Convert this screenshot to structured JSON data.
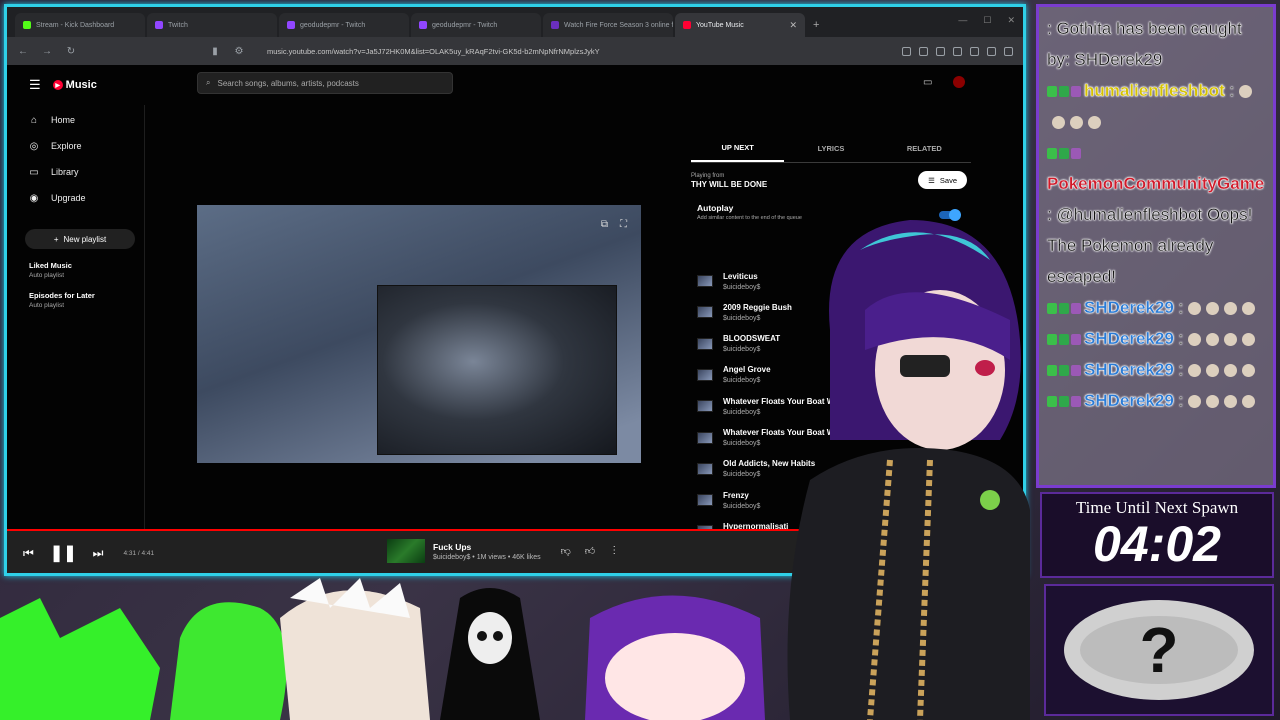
{
  "browser": {
    "tabs": [
      {
        "label": "Stream - Kick Dashboard",
        "color": "#53fc18"
      },
      {
        "label": "Twitch",
        "color": "#9146ff"
      },
      {
        "label": "geodudepmr - Twitch",
        "color": "#9146ff"
      },
      {
        "label": "geodudepmr - Twitch",
        "color": "#9146ff"
      },
      {
        "label": "Watch Fire Force Season 3 online fr",
        "color": "#6b2fbf"
      },
      {
        "label": "YouTube Music",
        "color": "#ff0033",
        "active": true
      }
    ],
    "new_tab": "+",
    "url": "music.youtube.com/watch?v=Ja5J72HK0M&list=OLAK5uy_kRAqF2tvi-GK5d-b2mNpNfrNMplzsJykY"
  },
  "ytm": {
    "brand": "Music",
    "search_placeholder": "Search songs, albums, artists, podcasts",
    "sidebar": {
      "items": [
        {
          "label": "Home",
          "icon": "⌂"
        },
        {
          "label": "Explore",
          "icon": "◎"
        },
        {
          "label": "Library",
          "icon": "▭"
        },
        {
          "label": "Upgrade",
          "icon": "◉"
        }
      ],
      "new_playlist": "New playlist",
      "playlists": [
        {
          "title": "Liked Music",
          "sub": "Auto playlist"
        },
        {
          "title": "Episodes for Later",
          "sub": "Auto playlist"
        }
      ]
    },
    "queue": {
      "tabs": [
        "UP NEXT",
        "LYRICS",
        "RELATED"
      ],
      "playing_from_label": "Playing from",
      "playing_from_title": "THY WILL BE DONE",
      "save_label": "Save",
      "autoplay_title": "Autoplay",
      "autoplay_sub": "Add similar content to the end of the queue",
      "items": [
        {
          "title": "Leviticus",
          "artist": "$uicideboy$"
        },
        {
          "title": "2009 Reggie Bush",
          "artist": "$uicideboy$"
        },
        {
          "title": "BLOODSWEAT",
          "artist": "$uicideboy$"
        },
        {
          "title": "Angel Grove",
          "artist": "$uicideboy$"
        },
        {
          "title": "Whatever Floats Your Boat Will Defir",
          "artist": "$uicideboy$"
        },
        {
          "title": "Whatever Floats Your Boat Will Definitely S",
          "artist": "$uicideboy$"
        },
        {
          "title": "Old Addicts, New Habits",
          "artist": "$uicideboy$"
        },
        {
          "title": "Frenzy",
          "artist": "$uicideboy$"
        },
        {
          "title": "Hypernormalisati",
          "artist": "$uicideboy$"
        },
        {
          "title": "Fuck Ups",
          "artist": "$uicideboy$"
        }
      ]
    },
    "player": {
      "time": "4:31 / 4:41",
      "progress": 0.964,
      "now_title": "Fuck Ups",
      "now_sub": "$uicideboy$ • 1M views • 46K likes"
    }
  },
  "chat": [
    {
      "name": "",
      "text": ": Gothita has been caught by: SHDerek29",
      "name_color": "#d01a2a"
    },
    {
      "name": "humalienfleshbot",
      "text": " :",
      "name_color": "#d6c200"
    },
    {
      "name": "PokemonCommunityGame",
      "text": "",
      "name_color": "#d01a2a"
    },
    {
      "name": "",
      "text": ": @humalienfleshbot Oops! The Pokemon already escaped!",
      "name_color": "#d01a2a"
    },
    {
      "name": "SHDerek29",
      "text": " :",
      "name_color": "#2a7bd6"
    },
    {
      "name": "SHDerek29",
      "text": " :",
      "name_color": "#2a7bd6"
    },
    {
      "name": "SHDerek29",
      "text": " :",
      "name_color": "#2a7bd6"
    },
    {
      "name": "SHDerek29",
      "text": " :",
      "name_color": "#2a7bd6"
    }
  ],
  "overlay": {
    "timer_label": "Time Until Next Spawn",
    "timer_value": "04:02",
    "mystery_symbol": "?"
  }
}
